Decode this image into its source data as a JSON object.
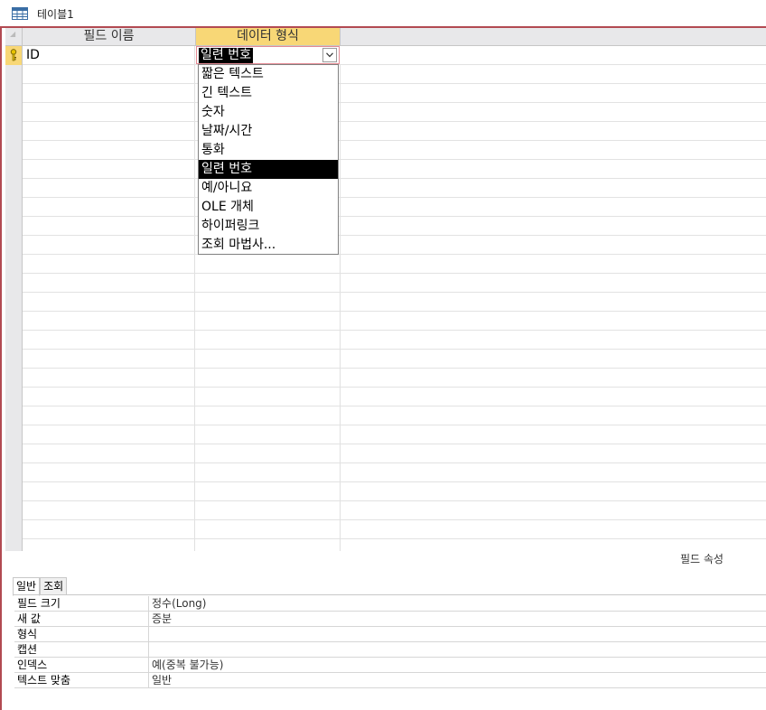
{
  "document_tab": {
    "icon": "table-icon",
    "title": "테이블1"
  },
  "grid": {
    "columns": {
      "field_name": "필드 이름",
      "data_type": "데이터 형식"
    },
    "rows": [
      {
        "field_name": "ID",
        "data_type": "일련 번호",
        "primary_key": true
      }
    ],
    "empty_row_count": 26
  },
  "data_type_dropdown": {
    "current_value": "일련 번호",
    "options": [
      "짧은 텍스트",
      "긴 텍스트",
      "숫자",
      "날짜/시간",
      "통화",
      "일련 번호",
      "예/아니요",
      "OLE 개체",
      "하이퍼링크",
      "조회 마법사..."
    ],
    "selected_index": 5
  },
  "field_properties": {
    "caption": "필드 속성",
    "tabs": [
      "일반",
      "조회"
    ],
    "active_tab": 0,
    "rows": [
      {
        "label": "필드 크기",
        "value": "정수(Long)"
      },
      {
        "label": "새 값",
        "value": "증분"
      },
      {
        "label": "형식",
        "value": ""
      },
      {
        "label": "캡션",
        "value": ""
      },
      {
        "label": "인덱스",
        "value": "예(중복 불가능)"
      },
      {
        "label": "텍스트 맞춤",
        "value": "일반"
      }
    ]
  },
  "colors": {
    "accent": "#b24a52",
    "header_highlight": "#f8d776",
    "selection": "#000000"
  }
}
